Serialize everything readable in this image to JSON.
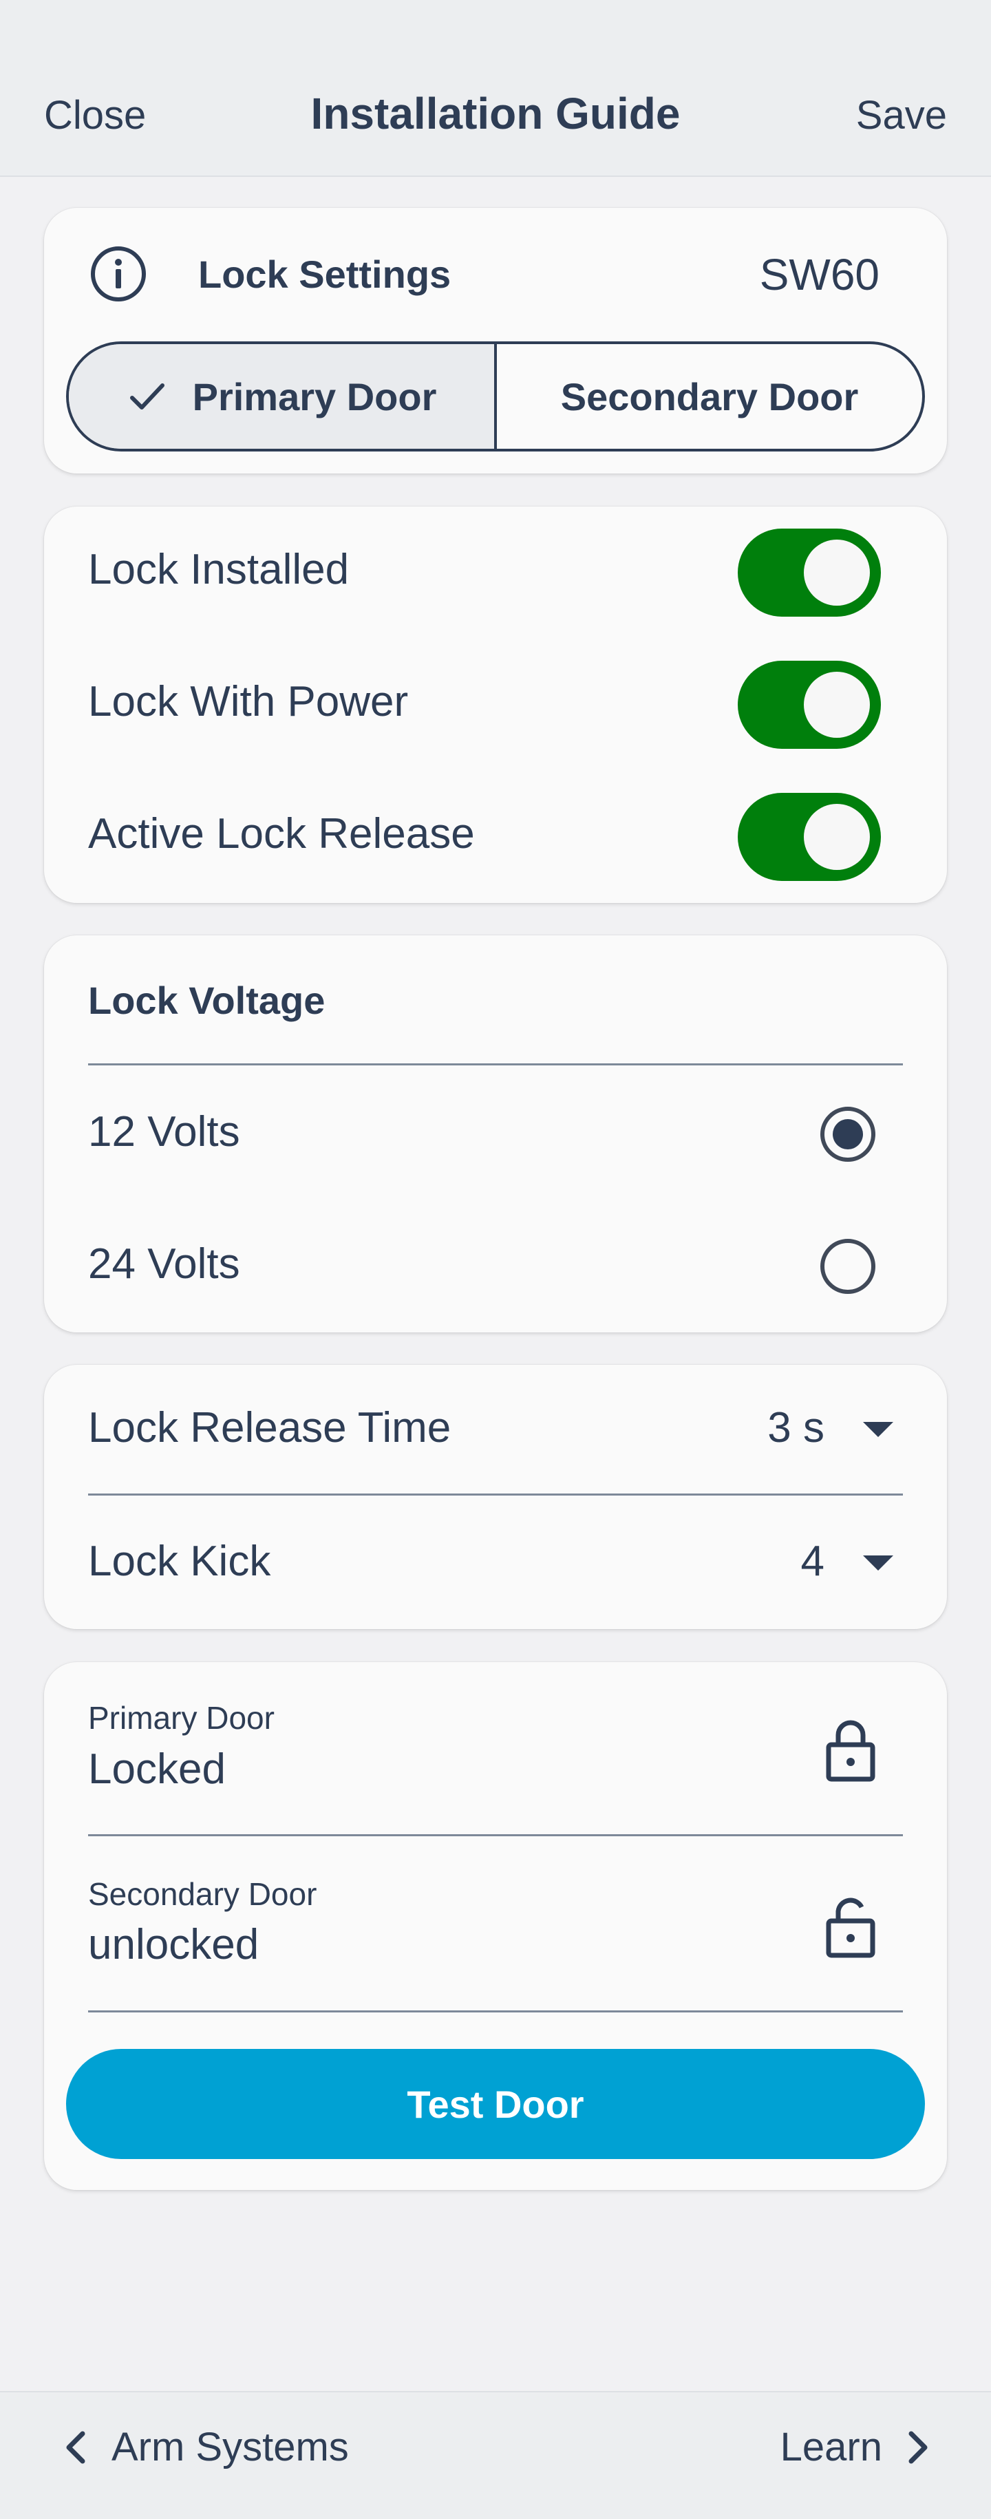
{
  "header": {
    "close_label": "Close",
    "title": "Installation Guide",
    "save_label": "Save"
  },
  "lock_settings": {
    "title": "Lock Settings",
    "model": "SW60",
    "doors": [
      {
        "label": "Primary Door",
        "selected": true
      },
      {
        "label": "Secondary Door",
        "selected": false
      }
    ]
  },
  "toggles": [
    {
      "label": "Lock Installed",
      "on": true
    },
    {
      "label": "Lock With Power",
      "on": true
    },
    {
      "label": "Active Lock Release",
      "on": true
    }
  ],
  "voltage": {
    "title": "Lock Voltage",
    "options": [
      {
        "label": "12 Volts",
        "selected": true
      },
      {
        "label": "24 Volts",
        "selected": false
      }
    ]
  },
  "selects": [
    {
      "label": "Lock Release Time",
      "value": "3 s"
    },
    {
      "label": "Lock Kick",
      "value": "4"
    }
  ],
  "status": {
    "items": [
      {
        "label": "Primary Door",
        "value": "Locked",
        "icon": "lock-closed-icon"
      },
      {
        "label": "Secondary Door",
        "value": "unlocked",
        "icon": "lock-open-icon"
      }
    ],
    "test_button": "Test Door"
  },
  "footer": {
    "back_label": "Arm Systems",
    "next_label": "Learn"
  },
  "colors": {
    "toggle_on": "#007f0c",
    "primary_button": "#00a1d3",
    "text": "#2e3d55"
  }
}
